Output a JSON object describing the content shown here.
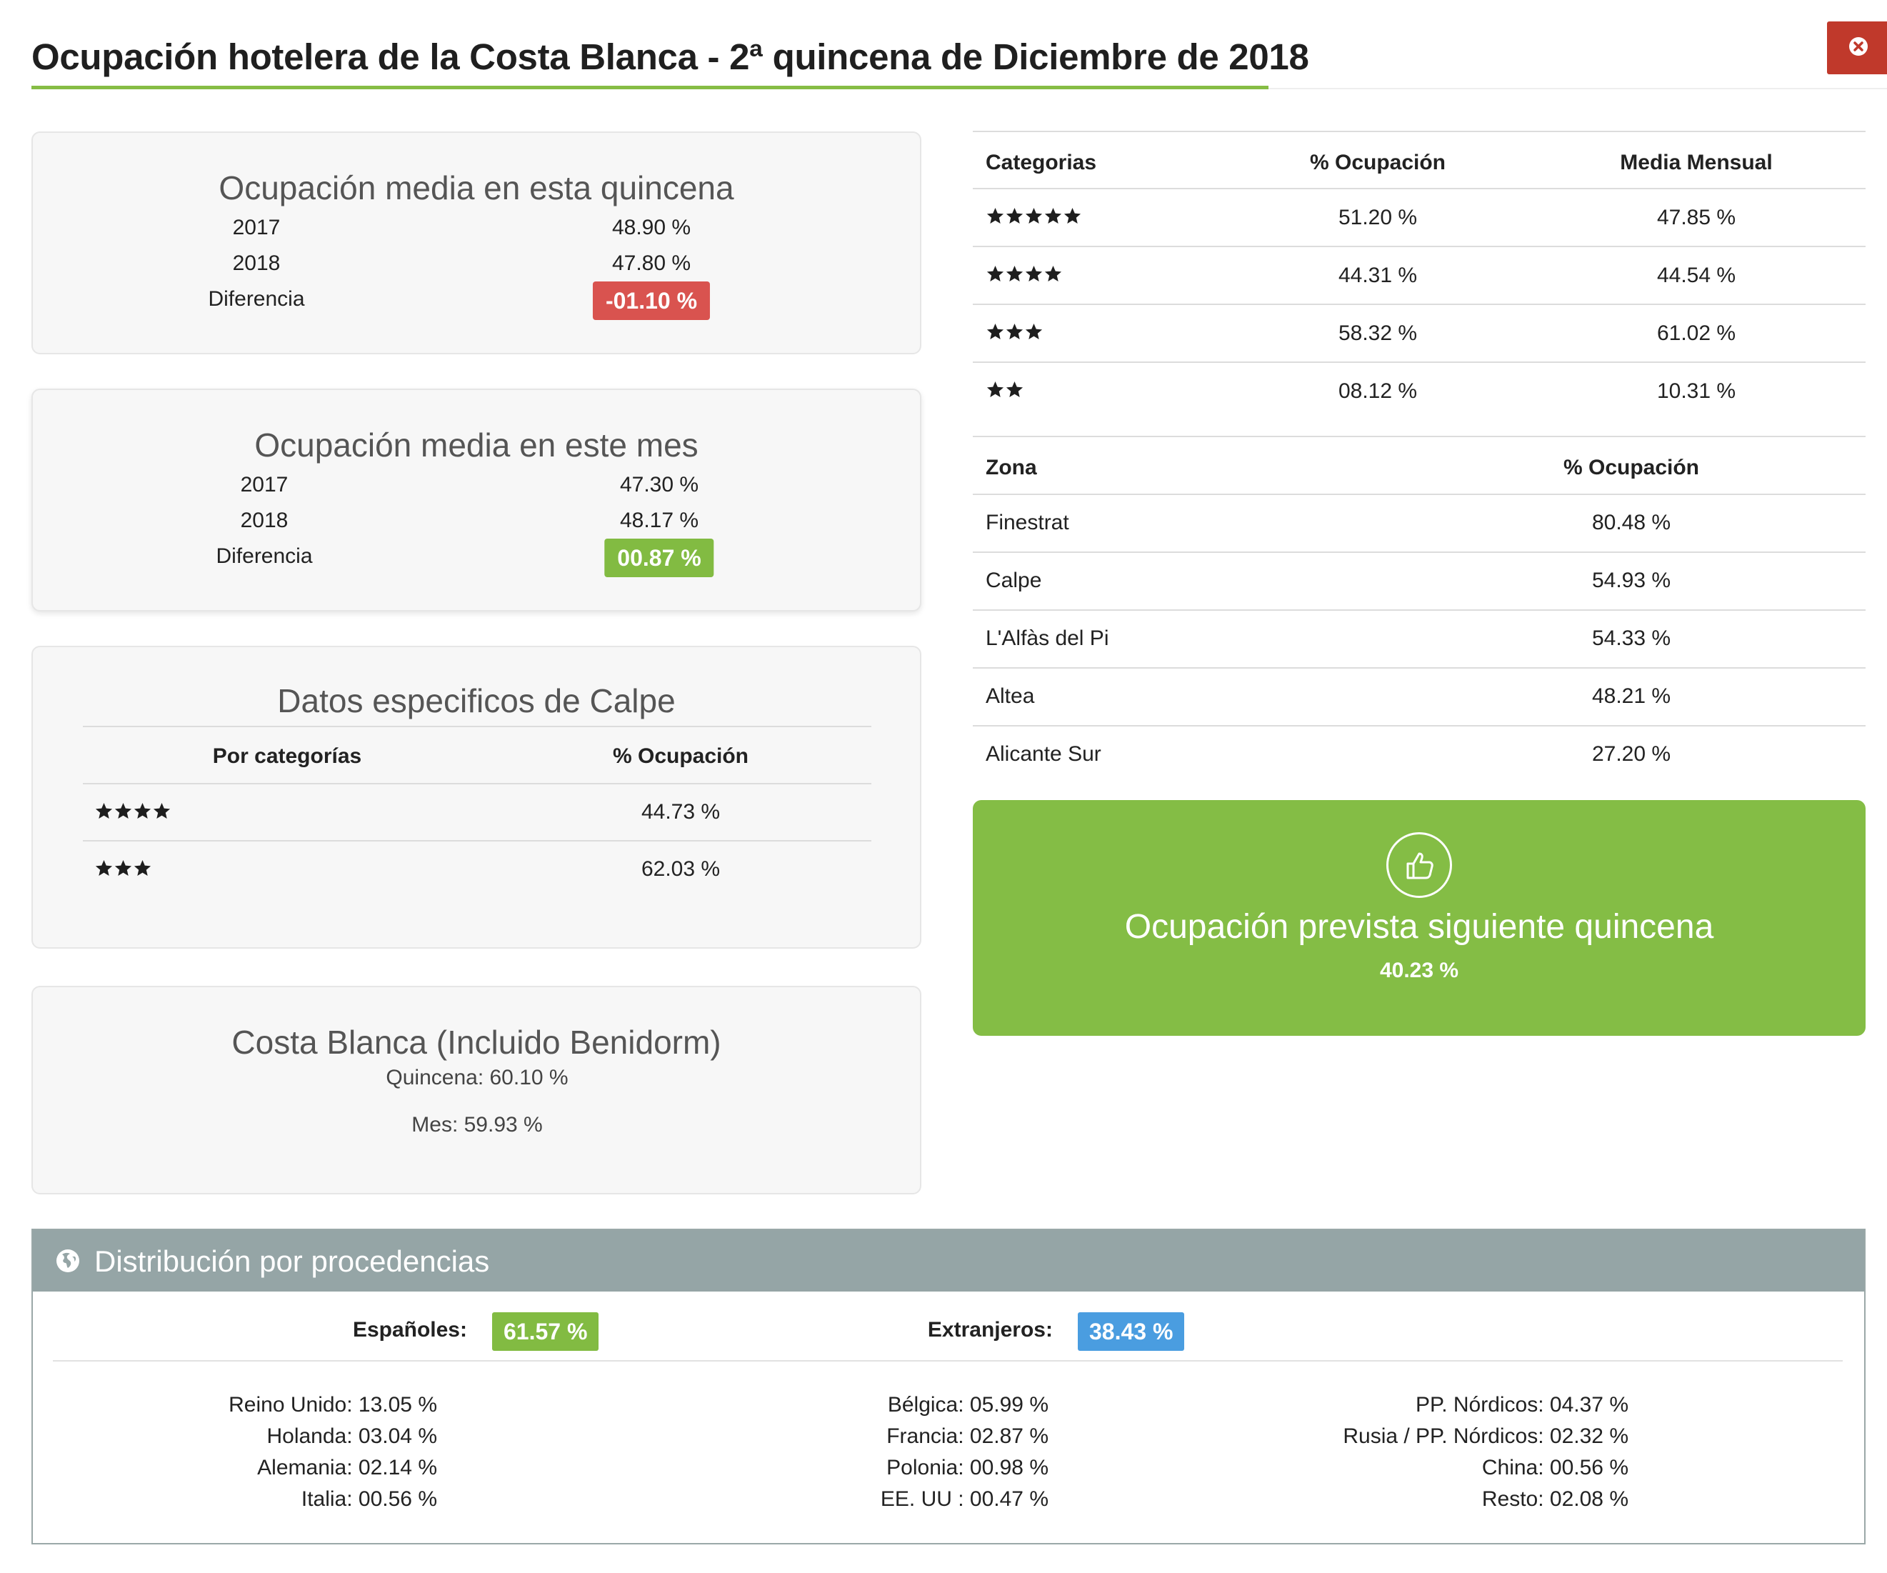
{
  "header": {
    "title": "Ocupación hotelera de la Costa Blanca - 2ª quincena de Diciembre de 2018"
  },
  "quincena": {
    "title": "Ocupación media en esta quincena",
    "rows": [
      {
        "label": "2017",
        "value": "48.90 %"
      },
      {
        "label": "2018",
        "value": "47.80 %"
      }
    ],
    "diff_label": "Diferencia",
    "diff_value": "-01.10 %"
  },
  "mes": {
    "title": "Ocupación media en este mes",
    "rows": [
      {
        "label": "2017",
        "value": "47.30 %"
      },
      {
        "label": "2018",
        "value": "48.17 %"
      }
    ],
    "diff_label": "Diferencia",
    "diff_value": "00.87 %"
  },
  "calpe": {
    "title": "Datos especificos de Calpe",
    "col1": "Por categorías",
    "col2": "% Ocupación",
    "rows": [
      {
        "stars": 4,
        "value": "44.73 %"
      },
      {
        "stars": 3,
        "value": "62.03 %"
      }
    ]
  },
  "costa": {
    "title": "Costa Blanca (Incluido Benidorm)",
    "quincena": "Quincena: 60.10 %",
    "mes": "Mes: 59.93 %"
  },
  "categorias": {
    "col1": "Categorias",
    "col2": "% Ocupación",
    "col3": "Media Mensual",
    "rows": [
      {
        "stars": 5,
        "ocupacion": "51.20 %",
        "media": "47.85 %"
      },
      {
        "stars": 4,
        "ocupacion": "44.31 %",
        "media": "44.54 %"
      },
      {
        "stars": 3,
        "ocupacion": "58.32 %",
        "media": "61.02 %"
      },
      {
        "stars": 2,
        "ocupacion": "08.12 %",
        "media": "10.31 %"
      }
    ]
  },
  "zonas": {
    "col1": "Zona",
    "col2": "% Ocupación",
    "rows": [
      {
        "zona": "Finestrat",
        "ocupacion": "80.48 %"
      },
      {
        "zona": "Calpe",
        "ocupacion": "54.93 %"
      },
      {
        "zona": "L'Alfàs del Pi",
        "ocupacion": "54.33 %"
      },
      {
        "zona": "Altea",
        "ocupacion": "48.21 %"
      },
      {
        "zona": "Alicante Sur",
        "ocupacion": "27.20 %"
      }
    ]
  },
  "forecast": {
    "icon": "thumbs-up-icon",
    "title": "Ocupación prevista siguiente quincena",
    "value": "40.23 %"
  },
  "distribucion": {
    "icon": "globe-icon",
    "title": "Distribución por procedencias",
    "espanoles_label": "Españoles:",
    "espanoles_value": "61.57 %",
    "extranjeros_label": "Extranjeros:",
    "extranjeros_value": "38.43 %",
    "columns": [
      [
        "Reino Unido: 13.05 %",
        "Holanda: 03.04 %",
        "Alemania: 02.14 %",
        "Italia: 00.56 %"
      ],
      [
        "Bélgica: 05.99 %",
        "Francia: 02.87 %",
        "Polonia: 00.98 %",
        "EE. UU : 00.47 %"
      ],
      [
        "PP. Nórdicos: 04.37 %",
        "Rusia / PP. Nórdicos: 02.32 %",
        "China: 00.56 %",
        "Resto: 02.08 %"
      ]
    ]
  },
  "colors": {
    "accent_green": "#84bd45",
    "negative_red": "#d9534f",
    "info_blue": "#4a9de0",
    "header_grey": "#95a5a6",
    "close_red": "#c0392b"
  }
}
